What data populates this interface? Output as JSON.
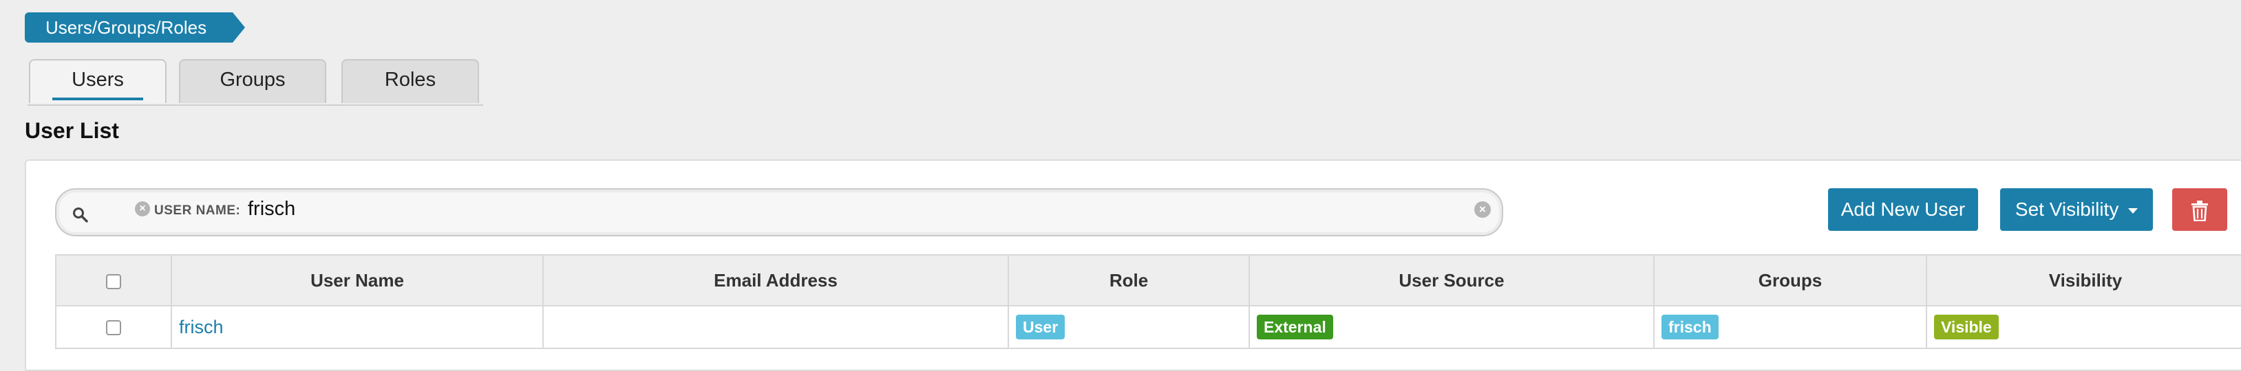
{
  "breadcrumb": {
    "label": "Users/Groups/Roles"
  },
  "tabs": [
    {
      "label": "Users"
    },
    {
      "label": "Groups"
    },
    {
      "label": "Roles"
    }
  ],
  "section": {
    "title": "User List"
  },
  "search": {
    "filter_label": "USER NAME:",
    "filter_value": "frisch",
    "remove_glyph": "×",
    "clear_glyph": "×"
  },
  "toolbar": {
    "add_label": "Add New User",
    "visibility_label": "Set Visibility"
  },
  "table": {
    "headers": [
      "User Name",
      "Email Address",
      "Role",
      "User Source",
      "Groups",
      "Visibility"
    ],
    "rows": [
      {
        "user_name": "frisch",
        "email": "",
        "role": "User",
        "source": "External",
        "groups": "frisch",
        "visibility": "Visible"
      }
    ]
  },
  "colors": {
    "accent": "#1b7faa",
    "danger": "#d9534f",
    "badge_info": "#5bc0de",
    "badge_success": "#3c9a1e",
    "badge_visible": "#8fb21e"
  },
  "icons": {
    "search": "search-icon",
    "delete": "trash-icon",
    "caret": "caret-down-icon",
    "chip_remove": "close-circle-icon",
    "clear": "close-circle-icon"
  }
}
